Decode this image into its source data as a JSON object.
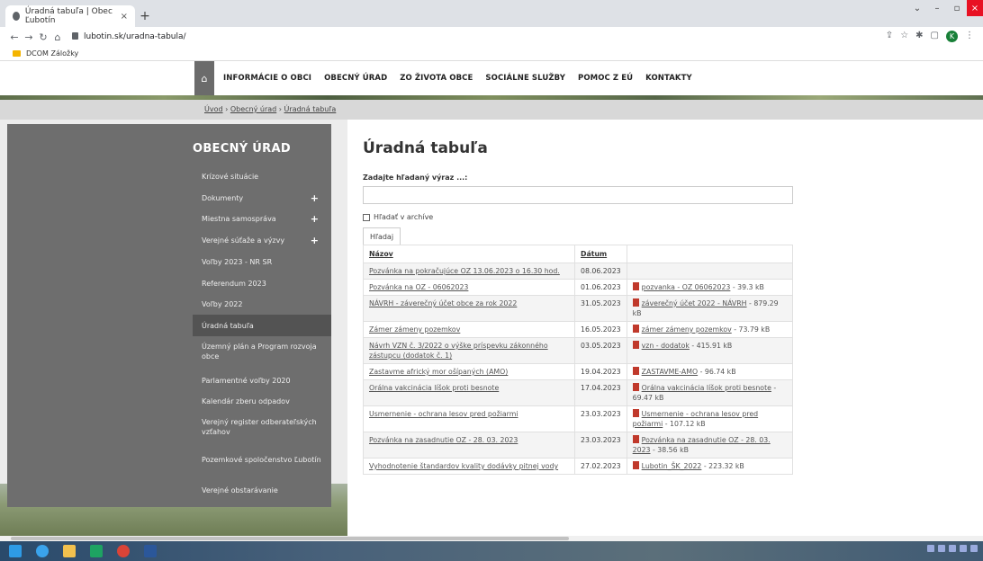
{
  "browser": {
    "tab_title": "Úradná tabuľa | Obec Ľubotín",
    "tab_close": "×",
    "new_tab": "+",
    "url": "lubotin.sk/uradna-tabula/",
    "bookmark_folder": "DCOM Záložky",
    "profile_initial": "K"
  },
  "nav": {
    "home_icon": "home-icon",
    "items": [
      "INFORMÁCIE O OBCI",
      "OBECNÝ ÚRAD",
      "ZO ŽIVOTA OBCE",
      "SOCIÁLNE SLUŽBY",
      "POMOC Z EÚ",
      "KONTAKTY"
    ]
  },
  "breadcrumb": {
    "items": [
      "Úvod",
      "Obecný úrad",
      "Úradná tabuľa"
    ],
    "separator": "›"
  },
  "sidebar": {
    "title": "OBECNÝ ÚRAD",
    "items": [
      {
        "label": "Krízové situácie",
        "expandable": false
      },
      {
        "label": "Dokumenty",
        "expandable": true
      },
      {
        "label": "Miestna samospráva",
        "expandable": true
      },
      {
        "label": "Verejné súťaže a výzvy",
        "expandable": true
      },
      {
        "label": "Voľby 2023 - NR SR",
        "expandable": false
      },
      {
        "label": "Referendum 2023",
        "expandable": false
      },
      {
        "label": "Voľby 2022",
        "expandable": false
      },
      {
        "label": "Úradná tabuľa",
        "expandable": false,
        "active": true
      },
      {
        "label": "Územný plán a Program rozvoja obce",
        "expandable": false
      },
      {
        "label": "Parlamentné voľby 2020",
        "expandable": false
      },
      {
        "label": "Kalendár zberu odpadov",
        "expandable": false
      },
      {
        "label": "Verejný register odberateľských vzťahov",
        "expandable": false
      },
      {
        "label": "Pozemkové spoločenstvo Ľubotín",
        "expandable": false
      },
      {
        "label": "Verejné obstarávanie",
        "expandable": false
      }
    ],
    "plus_glyph": "+"
  },
  "main": {
    "title": "Úradná tabuľa",
    "search_label": "Zadajte hľadaný výraz ...:",
    "search_value": "",
    "archive_label": "Hľadať v archíve",
    "search_button": "Hľadaj",
    "columns": [
      "Názov",
      "Dátum",
      ""
    ],
    "rows": [
      {
        "name": "Pozvánka na pokračujúce OZ 13.06.2023 o 16.30 hod.",
        "date": "08.06.2023",
        "att_name": "",
        "att_size": ""
      },
      {
        "name": "Pozvánka na OZ - 06062023",
        "date": "01.06.2023",
        "att_name": "pozvanka - OZ 06062023",
        "att_size": " - 39.3 kB"
      },
      {
        "name": "NÁVRH - záverečný účet obce za rok 2022",
        "date": "31.05.2023",
        "att_name": "záverečný účet 2022 - NÁVRH",
        "att_size": " - 879.29 kB"
      },
      {
        "name": "Zámer zámeny pozemkov",
        "date": "16.05.2023",
        "att_name": "zámer zámeny pozemkov",
        "att_size": " - 73.79 kB"
      },
      {
        "name": "Návrh VZN č. 3/2022 o výške príspevku zákonného zástupcu (dodatok č. 1)",
        "date": "03.05.2023",
        "att_name": "vzn - dodatok",
        "att_size": " - 415.91 kB"
      },
      {
        "name": "Zastavme africký mor ošípaných (AMO)",
        "date": "19.04.2023",
        "att_name": "ZASTAVME-AMO",
        "att_size": " - 96.74 kB"
      },
      {
        "name": "Orálna vakcinácia líšok proti besnote",
        "date": "17.04.2023",
        "att_name": "Orálna vakcinácia líšok proti besnote",
        "att_size": " - 69.47 kB"
      },
      {
        "name": "Usmernenie - ochrana lesov pred požiarmi",
        "date": "23.03.2023",
        "att_name": "Usmernenie - ochrana lesov pred požiarmi",
        "att_size": " - 107.12 kB"
      },
      {
        "name": "Pozvánka na zasadnutie OZ - 28. 03. 2023",
        "date": "23.03.2023",
        "att_name": "Pozvánka na zasadnutie OZ - 28. 03. 2023",
        "att_size": " - 38.56 kB"
      },
      {
        "name": "Vyhodnotenie štandardov kvality dodávky pitnej vody",
        "date": "27.02.2023",
        "att_name": "Lubotin_ŠK_2022",
        "att_size": " - 223.32 kB"
      }
    ]
  },
  "colors": {
    "sidebar_bg": "#6e6e6e",
    "sidebar_active": "#535353",
    "crumb_bg": "#d8d8d8",
    "pdf_icon": "#c0392b"
  }
}
